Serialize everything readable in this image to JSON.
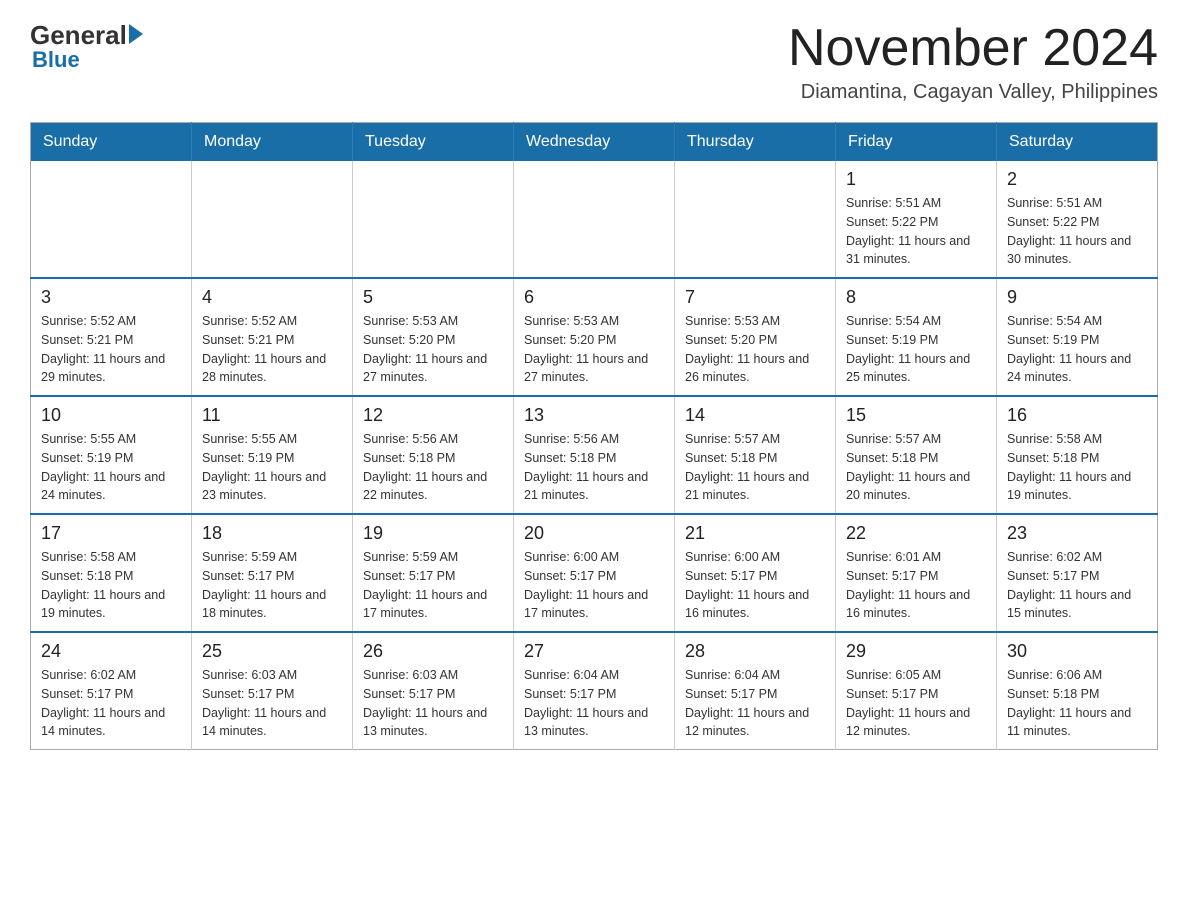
{
  "logo": {
    "general": "General",
    "blue": "Blue"
  },
  "title": "November 2024",
  "location": "Diamantina, Cagayan Valley, Philippines",
  "weekdays": [
    "Sunday",
    "Monday",
    "Tuesday",
    "Wednesday",
    "Thursday",
    "Friday",
    "Saturday"
  ],
  "weeks": [
    [
      {
        "day": "",
        "info": ""
      },
      {
        "day": "",
        "info": ""
      },
      {
        "day": "",
        "info": ""
      },
      {
        "day": "",
        "info": ""
      },
      {
        "day": "",
        "info": ""
      },
      {
        "day": "1",
        "info": "Sunrise: 5:51 AM\nSunset: 5:22 PM\nDaylight: 11 hours and 31 minutes."
      },
      {
        "day": "2",
        "info": "Sunrise: 5:51 AM\nSunset: 5:22 PM\nDaylight: 11 hours and 30 minutes."
      }
    ],
    [
      {
        "day": "3",
        "info": "Sunrise: 5:52 AM\nSunset: 5:21 PM\nDaylight: 11 hours and 29 minutes."
      },
      {
        "day": "4",
        "info": "Sunrise: 5:52 AM\nSunset: 5:21 PM\nDaylight: 11 hours and 28 minutes."
      },
      {
        "day": "5",
        "info": "Sunrise: 5:53 AM\nSunset: 5:20 PM\nDaylight: 11 hours and 27 minutes."
      },
      {
        "day": "6",
        "info": "Sunrise: 5:53 AM\nSunset: 5:20 PM\nDaylight: 11 hours and 27 minutes."
      },
      {
        "day": "7",
        "info": "Sunrise: 5:53 AM\nSunset: 5:20 PM\nDaylight: 11 hours and 26 minutes."
      },
      {
        "day": "8",
        "info": "Sunrise: 5:54 AM\nSunset: 5:19 PM\nDaylight: 11 hours and 25 minutes."
      },
      {
        "day": "9",
        "info": "Sunrise: 5:54 AM\nSunset: 5:19 PM\nDaylight: 11 hours and 24 minutes."
      }
    ],
    [
      {
        "day": "10",
        "info": "Sunrise: 5:55 AM\nSunset: 5:19 PM\nDaylight: 11 hours and 24 minutes."
      },
      {
        "day": "11",
        "info": "Sunrise: 5:55 AM\nSunset: 5:19 PM\nDaylight: 11 hours and 23 minutes."
      },
      {
        "day": "12",
        "info": "Sunrise: 5:56 AM\nSunset: 5:18 PM\nDaylight: 11 hours and 22 minutes."
      },
      {
        "day": "13",
        "info": "Sunrise: 5:56 AM\nSunset: 5:18 PM\nDaylight: 11 hours and 21 minutes."
      },
      {
        "day": "14",
        "info": "Sunrise: 5:57 AM\nSunset: 5:18 PM\nDaylight: 11 hours and 21 minutes."
      },
      {
        "day": "15",
        "info": "Sunrise: 5:57 AM\nSunset: 5:18 PM\nDaylight: 11 hours and 20 minutes."
      },
      {
        "day": "16",
        "info": "Sunrise: 5:58 AM\nSunset: 5:18 PM\nDaylight: 11 hours and 19 minutes."
      }
    ],
    [
      {
        "day": "17",
        "info": "Sunrise: 5:58 AM\nSunset: 5:18 PM\nDaylight: 11 hours and 19 minutes."
      },
      {
        "day": "18",
        "info": "Sunrise: 5:59 AM\nSunset: 5:17 PM\nDaylight: 11 hours and 18 minutes."
      },
      {
        "day": "19",
        "info": "Sunrise: 5:59 AM\nSunset: 5:17 PM\nDaylight: 11 hours and 17 minutes."
      },
      {
        "day": "20",
        "info": "Sunrise: 6:00 AM\nSunset: 5:17 PM\nDaylight: 11 hours and 17 minutes."
      },
      {
        "day": "21",
        "info": "Sunrise: 6:00 AM\nSunset: 5:17 PM\nDaylight: 11 hours and 16 minutes."
      },
      {
        "day": "22",
        "info": "Sunrise: 6:01 AM\nSunset: 5:17 PM\nDaylight: 11 hours and 16 minutes."
      },
      {
        "day": "23",
        "info": "Sunrise: 6:02 AM\nSunset: 5:17 PM\nDaylight: 11 hours and 15 minutes."
      }
    ],
    [
      {
        "day": "24",
        "info": "Sunrise: 6:02 AM\nSunset: 5:17 PM\nDaylight: 11 hours and 14 minutes."
      },
      {
        "day": "25",
        "info": "Sunrise: 6:03 AM\nSunset: 5:17 PM\nDaylight: 11 hours and 14 minutes."
      },
      {
        "day": "26",
        "info": "Sunrise: 6:03 AM\nSunset: 5:17 PM\nDaylight: 11 hours and 13 minutes."
      },
      {
        "day": "27",
        "info": "Sunrise: 6:04 AM\nSunset: 5:17 PM\nDaylight: 11 hours and 13 minutes."
      },
      {
        "day": "28",
        "info": "Sunrise: 6:04 AM\nSunset: 5:17 PM\nDaylight: 11 hours and 12 minutes."
      },
      {
        "day": "29",
        "info": "Sunrise: 6:05 AM\nSunset: 5:17 PM\nDaylight: 11 hours and 12 minutes."
      },
      {
        "day": "30",
        "info": "Sunrise: 6:06 AM\nSunset: 5:18 PM\nDaylight: 11 hours and 11 minutes."
      }
    ]
  ]
}
